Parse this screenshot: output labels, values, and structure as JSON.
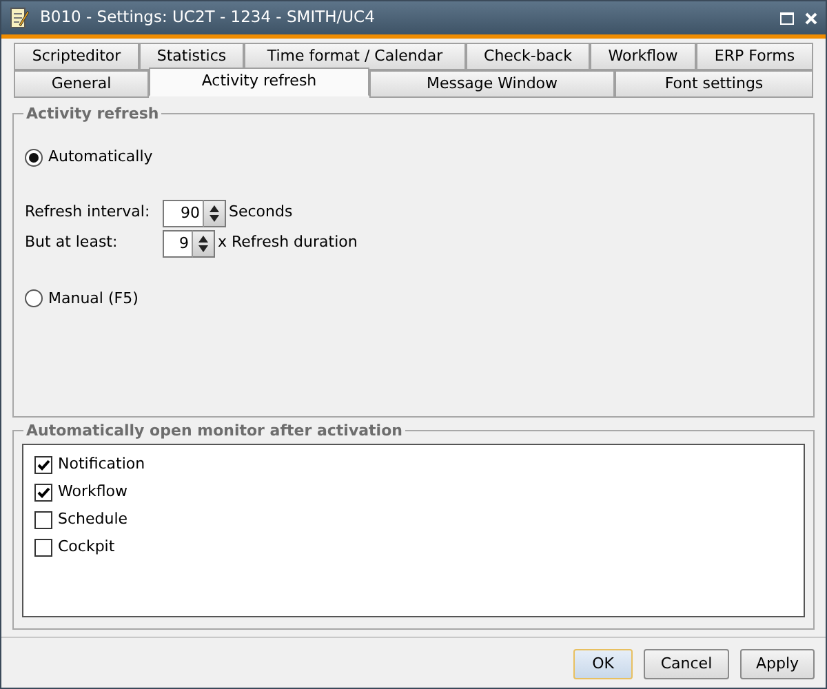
{
  "window": {
    "title": "B010 - Settings: UC2T - 1234 - SMITH/UC4"
  },
  "tab_rows": [
    {
      "tabs": [
        {
          "label": "Scripteditor",
          "selected": false
        },
        {
          "label": "Statistics",
          "selected": false
        },
        {
          "label": "Time format / Calendar",
          "selected": false
        },
        {
          "label": "Check-back",
          "selected": false
        },
        {
          "label": "Workflow",
          "selected": false
        },
        {
          "label": "ERP Forms",
          "selected": false
        }
      ]
    },
    {
      "tabs": [
        {
          "label": "General",
          "selected": false
        },
        {
          "label": "Activity refresh",
          "selected": true
        },
        {
          "label": "Message Window",
          "selected": false
        },
        {
          "label": "Font settings",
          "selected": false
        }
      ]
    }
  ],
  "activity_refresh": {
    "title": "Activity refresh",
    "options": [
      {
        "label": "Automatically",
        "selected": true
      },
      {
        "label": "Manual (F5)",
        "selected": false
      }
    ],
    "fields": [
      {
        "label": "Refresh interval:",
        "value": "90",
        "unit": "Seconds"
      },
      {
        "label": "But at least:",
        "value": "9",
        "unit": "x Refresh duration"
      }
    ]
  },
  "monitor": {
    "title": "Automatically open monitor after activation",
    "items": [
      {
        "label": "Notification",
        "checked": true
      },
      {
        "label": "Workflow",
        "checked": true
      },
      {
        "label": "Schedule",
        "checked": false
      },
      {
        "label": "Cockpit",
        "checked": false
      }
    ]
  },
  "buttons": [
    {
      "label": "OK",
      "default": true
    },
    {
      "label": "Cancel",
      "default": false
    },
    {
      "label": "Apply",
      "default": false
    }
  ]
}
